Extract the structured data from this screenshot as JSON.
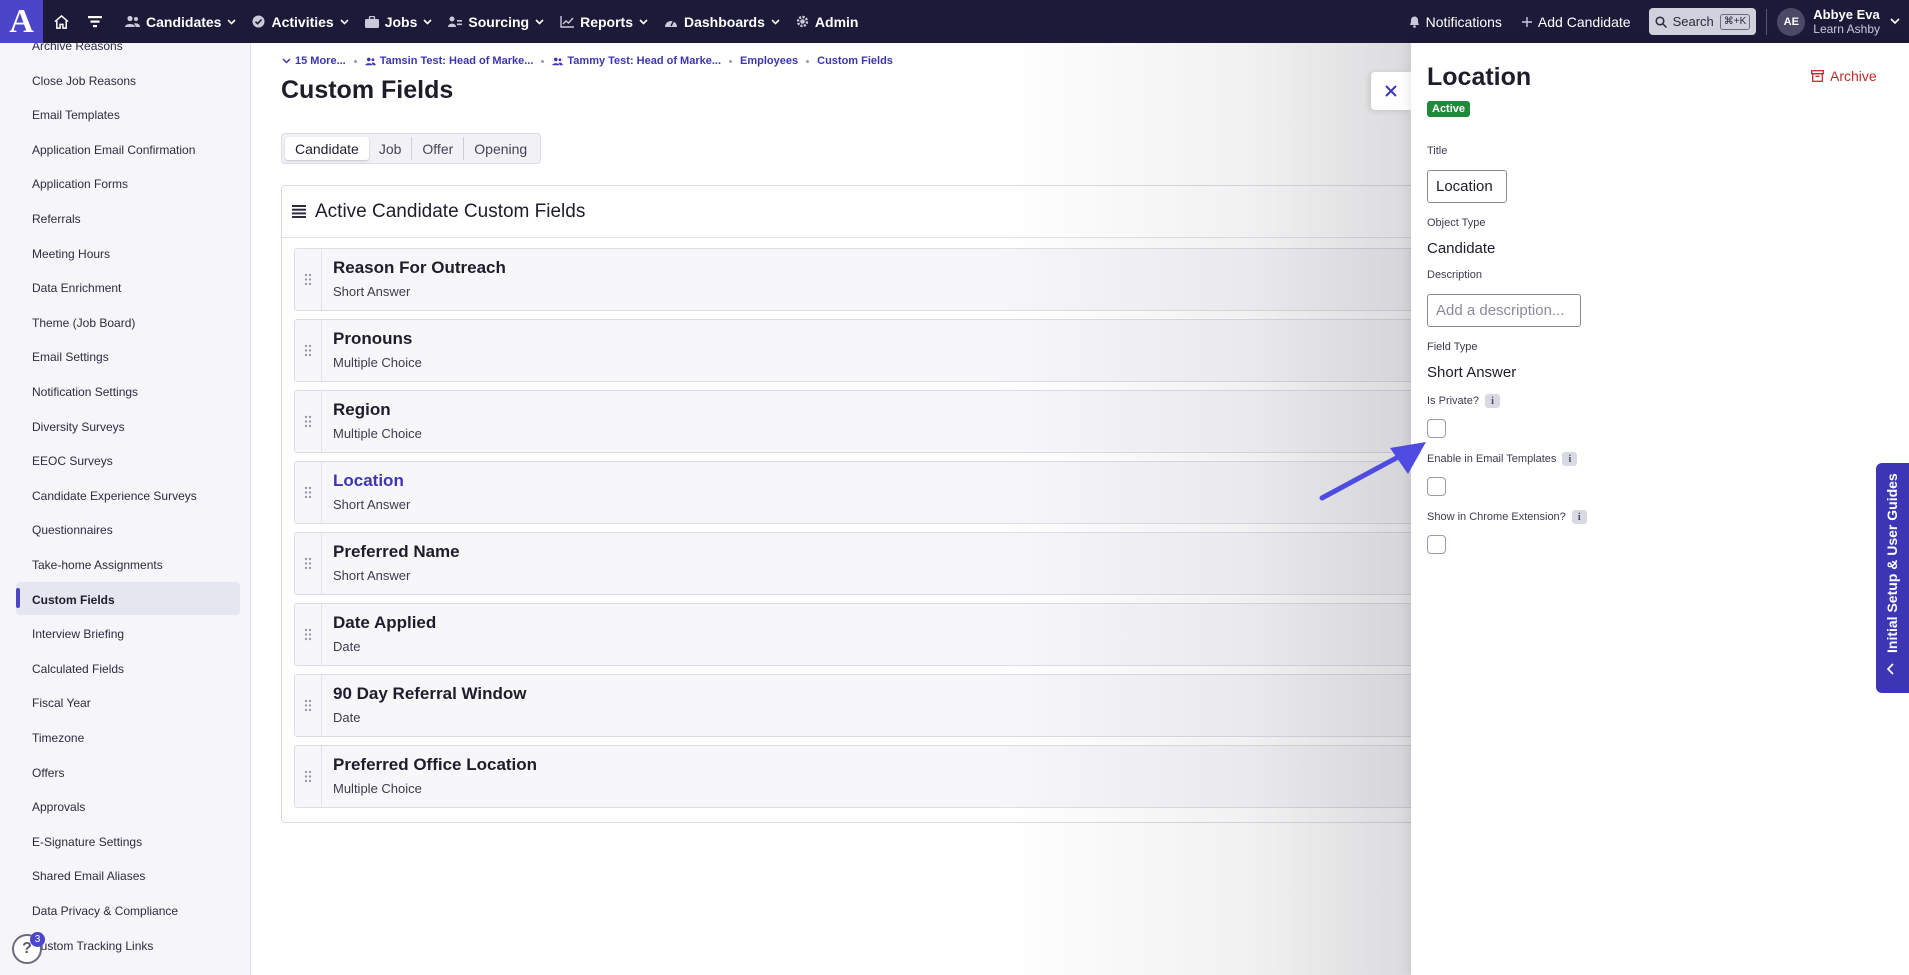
{
  "navbar": {
    "logo_letter": "A",
    "items": [
      {
        "label": "Candidates"
      },
      {
        "label": "Activities"
      },
      {
        "label": "Jobs"
      },
      {
        "label": "Sourcing"
      },
      {
        "label": "Reports"
      },
      {
        "label": "Dashboards"
      },
      {
        "label": "Admin"
      }
    ],
    "notifications_label": "Notifications",
    "add_candidate_label": "Add Candidate",
    "search_label": "Search",
    "search_shortcut": "⌘+K",
    "user_initials": "AE",
    "user_name": "Abbye Eva",
    "user_org": "Learn Ashby"
  },
  "sidebar": {
    "items": [
      "Archive Reasons",
      "Close Job Reasons",
      "Email Templates",
      "Application Email Confirmation",
      "Application Forms",
      "Referrals",
      "Meeting Hours",
      "Data Enrichment",
      "Theme (Job Board)",
      "Email Settings",
      "Notification Settings",
      "Diversity Surveys",
      "EEOC Surveys",
      "Candidate Experience Surveys",
      "Questionnaires",
      "Take-home Assignments",
      "Custom Fields",
      "Interview Briefing",
      "Calculated Fields",
      "Fiscal Year",
      "Timezone",
      "Offers",
      "Approvals",
      "E-Signature Settings",
      "Shared Email Aliases",
      "Data Privacy & Compliance",
      "Custom Tracking Links"
    ],
    "active_item": "Custom Fields",
    "help_badge_count": "3"
  },
  "breadcrumb": {
    "more_label": "15 More...",
    "items": [
      "Tamsin Test: Head of Marke...",
      "Tammy Test: Head of Marke...",
      "Employees",
      "Custom Fields"
    ]
  },
  "page": {
    "title": "Custom Fields",
    "tabs": [
      "Candidate",
      "Job",
      "Offer",
      "Opening"
    ],
    "active_tab": "Candidate",
    "card_title": "Active Candidate Custom Fields",
    "fields": [
      {
        "name": "Reason For Outreach",
        "type": "Short Answer"
      },
      {
        "name": "Pronouns",
        "type": "Multiple Choice"
      },
      {
        "name": "Region",
        "type": "Multiple Choice"
      },
      {
        "name": "Location",
        "type": "Short Answer"
      },
      {
        "name": "Preferred Name",
        "type": "Short Answer"
      },
      {
        "name": "Date Applied",
        "type": "Date"
      },
      {
        "name": "90 Day Referral Window",
        "type": "Date"
      },
      {
        "name": "Preferred Office Location",
        "type": "Multiple Choice"
      }
    ],
    "selected_field": "Location"
  },
  "panel": {
    "title": "Location",
    "archive_label": "Archive",
    "status": "Active",
    "title_label": "Title",
    "title_value": "Location",
    "object_type_label": "Object Type",
    "object_type_value": "Candidate",
    "description_label": "Description",
    "description_placeholder": "Add a description...",
    "field_type_label": "Field Type",
    "field_type_value": "Short Answer",
    "is_private_label": "Is Private?",
    "is_private_checked": false,
    "email_templates_label": "Enable in Email Templates",
    "email_templates_checked": false,
    "chrome_extension_label": "Show in Chrome Extension?",
    "chrome_extension_checked": false
  },
  "guide_tab": {
    "label": "Initial Setup & User Guides"
  },
  "colors": {
    "navbar_bg": "#1c1a38",
    "accent": "#4b45c9",
    "link": "#3c36b5",
    "archive_red": "#c42a2a",
    "active_green": "#1f8a3a"
  }
}
